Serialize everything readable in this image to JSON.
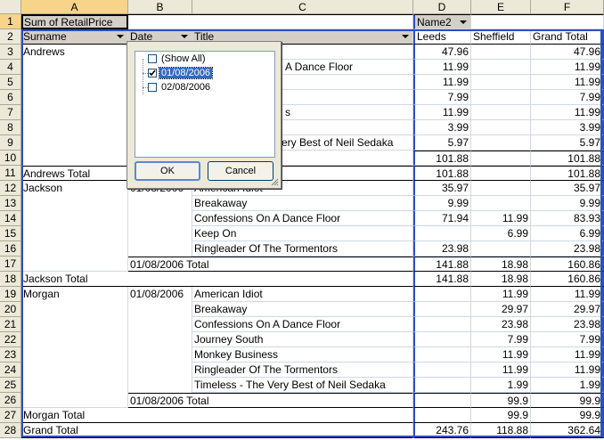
{
  "columns": [
    "A",
    "B",
    "C",
    "D",
    "E",
    "F"
  ],
  "rows": [
    1,
    2,
    3,
    4,
    5,
    6,
    7,
    8,
    9,
    10,
    11,
    12,
    13,
    14,
    15,
    16,
    17,
    18,
    19,
    20,
    21,
    22,
    23,
    24,
    25,
    26,
    27,
    28
  ],
  "pivot": {
    "data_field": "Sum of RetailPrice",
    "col_field": "Name2",
    "row_headers": {
      "surname": "Surname",
      "date": "Date",
      "title": "Title"
    },
    "col_headers": {
      "leeds": "Leeds",
      "sheffield": "Sheffield",
      "grand_total": "Grand Total"
    },
    "andrews": {
      "name": "Andrews",
      "visible_titles": [
        "A Dance Floor",
        "s",
        "ery Best of Neil Sedaka"
      ],
      "values": [
        [
          "47.96",
          "",
          "47.96"
        ],
        [
          "11.99",
          "",
          "11.99"
        ],
        [
          "11.99",
          "",
          "11.99"
        ],
        [
          "7.99",
          "",
          "7.99"
        ],
        [
          "11.99",
          "",
          "11.99"
        ],
        [
          "3.99",
          "",
          "3.99"
        ],
        [
          "5.97",
          "",
          "5.97"
        ],
        [
          "101.88",
          "",
          "101.88"
        ]
      ],
      "total_label": "Andrews Total",
      "total": [
        "101.88",
        "",
        "101.88"
      ]
    },
    "jackson": {
      "name": "Jackson",
      "date_partial": "01/08/2006",
      "first_title_partial": "American Idiot",
      "titles": [
        "Breakaway",
        "Confessions On A Dance Floor",
        "Keep On",
        "Ringleader Of The Tormentors"
      ],
      "values": [
        [
          "35.97",
          "",
          "35.97"
        ],
        [
          "9.99",
          "",
          "9.99"
        ],
        [
          "71.94",
          "11.99",
          "83.93"
        ],
        [
          "",
          "6.99",
          "6.99"
        ],
        [
          "23.98",
          "",
          "23.98"
        ]
      ],
      "date_total_label": "01/08/2006 Total",
      "date_total": [
        "141.88",
        "18.98",
        "160.86"
      ],
      "total_label": "Jackson Total",
      "total": [
        "141.88",
        "18.98",
        "160.86"
      ]
    },
    "morgan": {
      "name": "Morgan",
      "date": "01/08/2006",
      "titles": [
        "American Idiot",
        "Breakaway",
        "Confessions On A Dance Floor",
        "Journey South",
        "Monkey Business",
        "Ringleader Of The Tormentors",
        "Timeless - The Very Best of Neil Sedaka"
      ],
      "values": [
        [
          "",
          "11.99",
          "11.99"
        ],
        [
          "",
          "29.97",
          "29.97"
        ],
        [
          "",
          "23.98",
          "23.98"
        ],
        [
          "",
          "7.99",
          "7.99"
        ],
        [
          "",
          "11.99",
          "11.99"
        ],
        [
          "",
          "11.99",
          "11.99"
        ],
        [
          "",
          "1.99",
          "1.99"
        ]
      ],
      "date_total_label": "01/08/2006 Total",
      "date_total": [
        "",
        "99.9",
        "99.9"
      ],
      "total_label": "Morgan Total",
      "total": [
        "",
        "99.9",
        "99.9"
      ]
    },
    "grand_total_label": "Grand Total",
    "grand_total": [
      "243.76",
      "118.88",
      "362.64"
    ]
  },
  "filter_popup": {
    "options": [
      {
        "label": "(Show All)",
        "checked": false
      },
      {
        "label": "01/08/2006",
        "checked": true
      },
      {
        "label": "02/08/2006",
        "checked": false
      }
    ],
    "ok_label": "OK",
    "cancel_label": "Cancel"
  },
  "colors": {
    "header_bg": "#ece9d8",
    "selected_header": "#f8d38a",
    "pivot_border": "#2d4fbf",
    "highlight": "#316ac5"
  }
}
